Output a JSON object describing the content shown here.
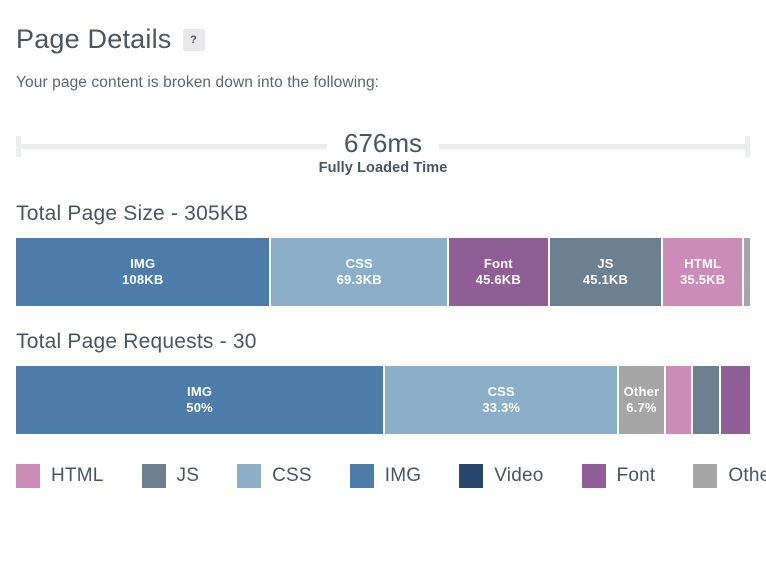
{
  "header": {
    "title": "Page Details",
    "help_badge": "?",
    "subtitle": "Your page content is broken down into the following:"
  },
  "load_time": {
    "value": "676ms",
    "label": "Fully Loaded Time"
  },
  "colors": {
    "HTML": "#cc8cb8",
    "JS": "#6c808f",
    "CSS": "#8cafc9",
    "IMG": "#4e7ca8",
    "Video": "#27466b",
    "Font": "#8f5e96",
    "Other": "#a6a6a6"
  },
  "page_size": {
    "heading": "Total Page Size - 305KB",
    "total": "305KB",
    "segments": [
      {
        "name": "IMG",
        "value": "108KB",
        "percent": 34.8,
        "color": "#4e7ca8",
        "show_label": true
      },
      {
        "name": "CSS",
        "value": "69.3KB",
        "percent": 24.2,
        "color": "#8cafc9",
        "show_label": true
      },
      {
        "name": "Font",
        "value": "45.6KB",
        "percent": 13.7,
        "color": "#8f5e96",
        "show_label": true
      },
      {
        "name": "JS",
        "value": "45.1KB",
        "percent": 15.5,
        "color": "#6c808f",
        "show_label": true
      },
      {
        "name": "HTML",
        "value": "35.5KB",
        "percent": 11.0,
        "color": "#cc8cb8",
        "show_label": true
      },
      {
        "name": "Other",
        "value": "",
        "percent": 0.8,
        "color": "#a6a6a6",
        "show_label": false
      }
    ]
  },
  "page_requests": {
    "heading": "Total Page Requests - 30",
    "total": "30",
    "segments": [
      {
        "name": "IMG",
        "value": "50%",
        "percent": 50.3,
        "color": "#4e7ca8",
        "show_label": true
      },
      {
        "name": "CSS",
        "value": "33.3%",
        "percent": 31.9,
        "color": "#8cafc9",
        "show_label": true
      },
      {
        "name": "Other",
        "value": "6.7%",
        "percent": 6.3,
        "color": "#a6a6a6",
        "show_label": true
      },
      {
        "name": "HTML",
        "value": "",
        "percent": 3.8,
        "color": "#cc8cb8",
        "show_label": false
      },
      {
        "name": "JS",
        "value": "",
        "percent": 3.8,
        "color": "#6c808f",
        "show_label": false
      },
      {
        "name": "Font",
        "value": "",
        "percent": 3.9,
        "color": "#8f5e96",
        "show_label": false
      }
    ]
  },
  "legend": {
    "items": [
      {
        "label": "HTML",
        "color": "#cc8cb8"
      },
      {
        "label": "JS",
        "color": "#6c808f"
      },
      {
        "label": "CSS",
        "color": "#8cafc9"
      },
      {
        "label": "IMG",
        "color": "#4e7ca8"
      },
      {
        "label": "Video",
        "color": "#27466b"
      },
      {
        "label": "Font",
        "color": "#8f5e96"
      },
      {
        "label": "Other",
        "color": "#a6a6a6"
      }
    ]
  },
  "chart_data": {
    "type": "bar",
    "title": "Page Details",
    "charts": [
      {
        "type": "bar",
        "orientation": "stacked-horizontal",
        "title": "Total Page Size - 305KB",
        "unit": "KB",
        "total": 305,
        "categories": [
          "IMG",
          "CSS",
          "Font",
          "JS",
          "HTML",
          "Other"
        ],
        "values": [
          108,
          69.3,
          45.6,
          45.1,
          35.5,
          1.5
        ],
        "labels": [
          "108KB",
          "69.3KB",
          "45.6KB",
          "45.1KB",
          "35.5KB",
          ""
        ]
      },
      {
        "type": "bar",
        "orientation": "stacked-horizontal",
        "title": "Total Page Requests - 30",
        "unit": "%",
        "total": 30,
        "categories": [
          "IMG",
          "CSS",
          "Other",
          "HTML",
          "JS",
          "Font"
        ],
        "values": [
          50,
          33.3,
          6.7,
          3.3,
          3.3,
          3.3
        ],
        "labels": [
          "50%",
          "33.3%",
          "6.7%",
          "",
          "",
          ""
        ]
      }
    ],
    "legend_position": "bottom",
    "grid": false
  }
}
